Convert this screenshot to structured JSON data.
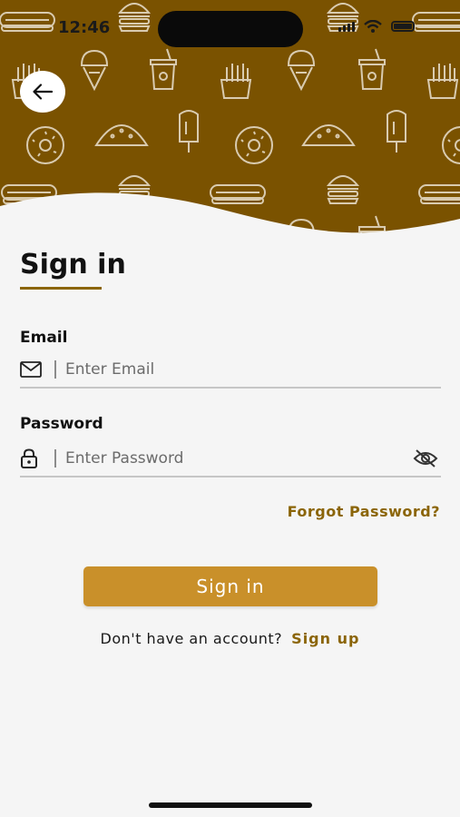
{
  "status_bar": {
    "time": "12:46"
  },
  "header": {
    "back_icon": "arrow-left-icon",
    "pattern_color": "#d9cbb0",
    "background_color": "#7a5200"
  },
  "form": {
    "title": "Sign in",
    "email": {
      "label": "Email",
      "placeholder": "Enter Email",
      "value": "",
      "icon": "mail-icon"
    },
    "password": {
      "label": "Password",
      "placeholder": "Enter Password",
      "value": "",
      "icon": "lock-icon",
      "toggle_icon": "eye-slash-icon"
    },
    "forgot_label": "Forgot Password?",
    "submit_label": "Sign in",
    "signup_prompt": "Don't have an account?",
    "signup_label": "Sign up"
  },
  "colors": {
    "accent": "#8b6508",
    "button": "#c9902a",
    "banner": "#7a5200"
  }
}
